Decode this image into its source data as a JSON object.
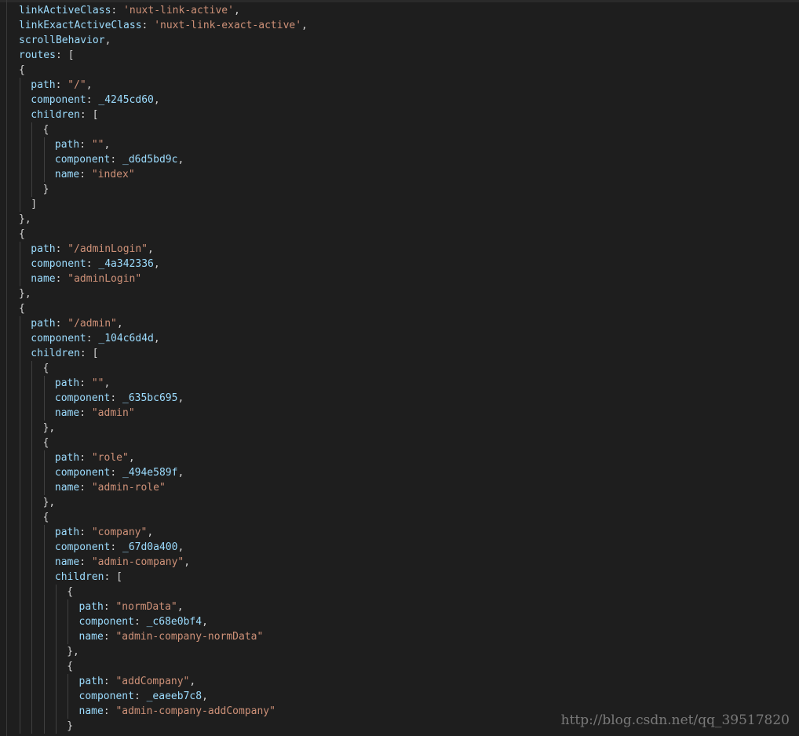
{
  "editor": {
    "lines": [
      {
        "indent": 0,
        "tokens": [
          {
            "t": "linkActiveClass",
            "c": "k"
          },
          {
            "t": ": ",
            "c": "p"
          },
          {
            "t": "'nuxt-link-active'",
            "c": "s"
          },
          {
            "t": ",",
            "c": "p"
          }
        ]
      },
      {
        "indent": 0,
        "tokens": [
          {
            "t": "linkExactActiveClass",
            "c": "k"
          },
          {
            "t": ": ",
            "c": "p"
          },
          {
            "t": "'nuxt-link-exact-active'",
            "c": "s"
          },
          {
            "t": ",",
            "c": "p"
          }
        ]
      },
      {
        "indent": 0,
        "tokens": [
          {
            "t": "scrollBehavior",
            "c": "k"
          },
          {
            "t": ",",
            "c": "p"
          }
        ]
      },
      {
        "indent": 0,
        "tokens": [
          {
            "t": "routes",
            "c": "k"
          },
          {
            "t": ": [",
            "c": "p"
          }
        ]
      },
      {
        "indent": 0,
        "tokens": [
          {
            "t": "{",
            "c": "p"
          }
        ]
      },
      {
        "indent": 1,
        "tokens": [
          {
            "t": "path",
            "c": "k"
          },
          {
            "t": ": ",
            "c": "p"
          },
          {
            "t": "\"/\"",
            "c": "s"
          },
          {
            "t": ",",
            "c": "p"
          }
        ]
      },
      {
        "indent": 1,
        "tokens": [
          {
            "t": "component",
            "c": "k"
          },
          {
            "t": ": ",
            "c": "p"
          },
          {
            "t": "_4245cd60",
            "c": "k"
          },
          {
            "t": ",",
            "c": "p"
          }
        ]
      },
      {
        "indent": 1,
        "tokens": [
          {
            "t": "children",
            "c": "k"
          },
          {
            "t": ": [",
            "c": "p"
          }
        ]
      },
      {
        "indent": 2,
        "tokens": [
          {
            "t": "{",
            "c": "p"
          }
        ]
      },
      {
        "indent": 3,
        "tokens": [
          {
            "t": "path",
            "c": "k"
          },
          {
            "t": ": ",
            "c": "p"
          },
          {
            "t": "\"\"",
            "c": "s"
          },
          {
            "t": ",",
            "c": "p"
          }
        ]
      },
      {
        "indent": 3,
        "tokens": [
          {
            "t": "component",
            "c": "k"
          },
          {
            "t": ": ",
            "c": "p"
          },
          {
            "t": "_d6d5bd9c",
            "c": "k"
          },
          {
            "t": ",",
            "c": "p"
          }
        ]
      },
      {
        "indent": 3,
        "tokens": [
          {
            "t": "name",
            "c": "k"
          },
          {
            "t": ": ",
            "c": "p"
          },
          {
            "t": "\"index\"",
            "c": "s"
          }
        ]
      },
      {
        "indent": 2,
        "tokens": [
          {
            "t": "}",
            "c": "p"
          }
        ]
      },
      {
        "indent": 1,
        "tokens": [
          {
            "t": "]",
            "c": "p"
          }
        ]
      },
      {
        "indent": 0,
        "tokens": [
          {
            "t": "},",
            "c": "p"
          }
        ]
      },
      {
        "indent": 0,
        "tokens": [
          {
            "t": "{",
            "c": "p"
          }
        ]
      },
      {
        "indent": 1,
        "tokens": [
          {
            "t": "path",
            "c": "k"
          },
          {
            "t": ": ",
            "c": "p"
          },
          {
            "t": "\"/adminLogin\"",
            "c": "s"
          },
          {
            "t": ",",
            "c": "p"
          }
        ]
      },
      {
        "indent": 1,
        "tokens": [
          {
            "t": "component",
            "c": "k"
          },
          {
            "t": ": ",
            "c": "p"
          },
          {
            "t": "_4a342336",
            "c": "k"
          },
          {
            "t": ",",
            "c": "p"
          }
        ]
      },
      {
        "indent": 1,
        "tokens": [
          {
            "t": "name",
            "c": "k"
          },
          {
            "t": ": ",
            "c": "p"
          },
          {
            "t": "\"adminLogin\"",
            "c": "s"
          }
        ]
      },
      {
        "indent": 0,
        "tokens": [
          {
            "t": "},",
            "c": "p"
          }
        ]
      },
      {
        "indent": 0,
        "tokens": [
          {
            "t": "{",
            "c": "p"
          }
        ]
      },
      {
        "indent": 1,
        "tokens": [
          {
            "t": "path",
            "c": "k"
          },
          {
            "t": ": ",
            "c": "p"
          },
          {
            "t": "\"/admin\"",
            "c": "s"
          },
          {
            "t": ",",
            "c": "p"
          }
        ]
      },
      {
        "indent": 1,
        "tokens": [
          {
            "t": "component",
            "c": "k"
          },
          {
            "t": ": ",
            "c": "p"
          },
          {
            "t": "_104c6d4d",
            "c": "k"
          },
          {
            "t": ",",
            "c": "p"
          }
        ]
      },
      {
        "indent": 1,
        "tokens": [
          {
            "t": "children",
            "c": "k"
          },
          {
            "t": ": [",
            "c": "p"
          }
        ]
      },
      {
        "indent": 2,
        "tokens": [
          {
            "t": "{",
            "c": "p"
          }
        ]
      },
      {
        "indent": 3,
        "tokens": [
          {
            "t": "path",
            "c": "k"
          },
          {
            "t": ": ",
            "c": "p"
          },
          {
            "t": "\"\"",
            "c": "s"
          },
          {
            "t": ",",
            "c": "p"
          }
        ]
      },
      {
        "indent": 3,
        "tokens": [
          {
            "t": "component",
            "c": "k"
          },
          {
            "t": ": ",
            "c": "p"
          },
          {
            "t": "_635bc695",
            "c": "k"
          },
          {
            "t": ",",
            "c": "p"
          }
        ]
      },
      {
        "indent": 3,
        "tokens": [
          {
            "t": "name",
            "c": "k"
          },
          {
            "t": ": ",
            "c": "p"
          },
          {
            "t": "\"admin\"",
            "c": "s"
          }
        ]
      },
      {
        "indent": 2,
        "tokens": [
          {
            "t": "},",
            "c": "p"
          }
        ]
      },
      {
        "indent": 2,
        "tokens": [
          {
            "t": "{",
            "c": "p"
          }
        ]
      },
      {
        "indent": 3,
        "tokens": [
          {
            "t": "path",
            "c": "k"
          },
          {
            "t": ": ",
            "c": "p"
          },
          {
            "t": "\"role\"",
            "c": "s"
          },
          {
            "t": ",",
            "c": "p"
          }
        ]
      },
      {
        "indent": 3,
        "tokens": [
          {
            "t": "component",
            "c": "k"
          },
          {
            "t": ": ",
            "c": "p"
          },
          {
            "t": "_494e589f",
            "c": "k"
          },
          {
            "t": ",",
            "c": "p"
          }
        ]
      },
      {
        "indent": 3,
        "tokens": [
          {
            "t": "name",
            "c": "k"
          },
          {
            "t": ": ",
            "c": "p"
          },
          {
            "t": "\"admin-role\"",
            "c": "s"
          }
        ]
      },
      {
        "indent": 2,
        "tokens": [
          {
            "t": "},",
            "c": "p"
          }
        ]
      },
      {
        "indent": 2,
        "tokens": [
          {
            "t": "{",
            "c": "p"
          }
        ]
      },
      {
        "indent": 3,
        "tokens": [
          {
            "t": "path",
            "c": "k"
          },
          {
            "t": ": ",
            "c": "p"
          },
          {
            "t": "\"company\"",
            "c": "s"
          },
          {
            "t": ",",
            "c": "p"
          }
        ]
      },
      {
        "indent": 3,
        "tokens": [
          {
            "t": "component",
            "c": "k"
          },
          {
            "t": ": ",
            "c": "p"
          },
          {
            "t": "_67d0a400",
            "c": "k"
          },
          {
            "t": ",",
            "c": "p"
          }
        ]
      },
      {
        "indent": 3,
        "tokens": [
          {
            "t": "name",
            "c": "k"
          },
          {
            "t": ": ",
            "c": "p"
          },
          {
            "t": "\"admin-company\"",
            "c": "s"
          },
          {
            "t": ",",
            "c": "p"
          }
        ]
      },
      {
        "indent": 3,
        "tokens": [
          {
            "t": "children",
            "c": "k"
          },
          {
            "t": ": [",
            "c": "p"
          }
        ]
      },
      {
        "indent": 4,
        "tokens": [
          {
            "t": "{",
            "c": "p"
          }
        ]
      },
      {
        "indent": 5,
        "tokens": [
          {
            "t": "path",
            "c": "k"
          },
          {
            "t": ": ",
            "c": "p"
          },
          {
            "t": "\"normData\"",
            "c": "s"
          },
          {
            "t": ",",
            "c": "p"
          }
        ]
      },
      {
        "indent": 5,
        "tokens": [
          {
            "t": "component",
            "c": "k"
          },
          {
            "t": ": ",
            "c": "p"
          },
          {
            "t": "_c68e0bf4",
            "c": "k"
          },
          {
            "t": ",",
            "c": "p"
          }
        ]
      },
      {
        "indent": 5,
        "tokens": [
          {
            "t": "name",
            "c": "k"
          },
          {
            "t": ": ",
            "c": "p"
          },
          {
            "t": "\"admin-company-normData\"",
            "c": "s"
          }
        ]
      },
      {
        "indent": 4,
        "tokens": [
          {
            "t": "},",
            "c": "p"
          }
        ]
      },
      {
        "indent": 4,
        "tokens": [
          {
            "t": "{",
            "c": "p"
          }
        ]
      },
      {
        "indent": 5,
        "tokens": [
          {
            "t": "path",
            "c": "k"
          },
          {
            "t": ": ",
            "c": "p"
          },
          {
            "t": "\"addCompany\"",
            "c": "s"
          },
          {
            "t": ",",
            "c": "p"
          }
        ]
      },
      {
        "indent": 5,
        "tokens": [
          {
            "t": "component",
            "c": "k"
          },
          {
            "t": ": ",
            "c": "p"
          },
          {
            "t": "_eaeeb7c8",
            "c": "k"
          },
          {
            "t": ",",
            "c": "p"
          }
        ]
      },
      {
        "indent": 5,
        "tokens": [
          {
            "t": "name",
            "c": "k"
          },
          {
            "t": ": ",
            "c": "p"
          },
          {
            "t": "\"admin-company-addCompany\"",
            "c": "s"
          }
        ]
      },
      {
        "indent": 4,
        "tokens": [
          {
            "t": "}",
            "c": "p"
          }
        ]
      }
    ]
  },
  "watermark": {
    "text": "http://blog.csdn.net/qq_39517820"
  },
  "colors": {
    "background": "#1e1e1e",
    "property": "#9cdcfe",
    "string": "#ce9178",
    "punctuation": "#d4d4d4",
    "indent_guide": "#404040"
  }
}
